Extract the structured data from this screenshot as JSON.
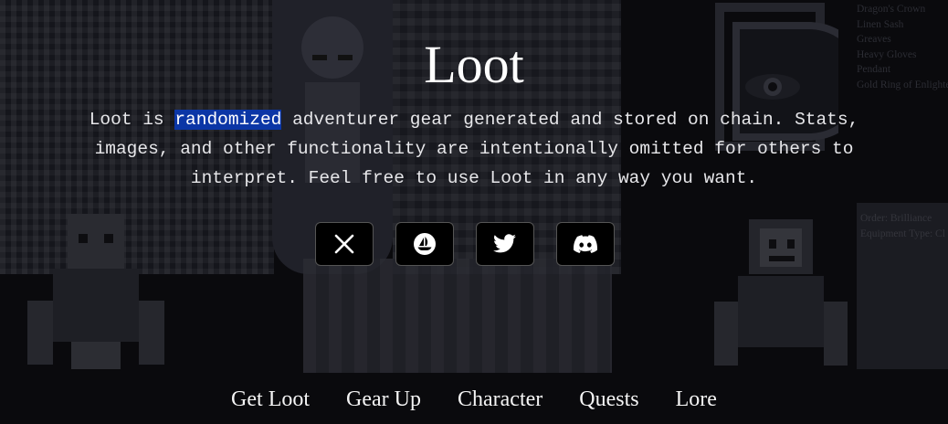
{
  "hero": {
    "title": "Loot",
    "description_before": "Loot is ",
    "description_highlight": "randomized",
    "description_after": " adventurer gear generated and stored on chain. Stats, images, and other functionality are intentionally omitted for others to interpret. Feel free to use Loot in any way you want."
  },
  "socials": [
    {
      "name": "x-icon"
    },
    {
      "name": "opensea-icon"
    },
    {
      "name": "twitter-icon"
    },
    {
      "name": "discord-icon"
    }
  ],
  "nav": {
    "items": [
      "Get Loot",
      "Gear Up",
      "Character",
      "Quests",
      "Lore"
    ]
  },
  "background": {
    "gear_list": [
      "Dragon's Crown",
      "Linen Sash",
      "Greaves",
      "Heavy Gloves",
      "Pendant",
      "Gold Ring of Enlightenment"
    ],
    "order": "Order: Brilliance",
    "equipment_type": "Equipment Type: Cl"
  },
  "colors": {
    "background": "#0a0a0d",
    "highlight": "#0b36a6",
    "text": "#ffffff"
  }
}
